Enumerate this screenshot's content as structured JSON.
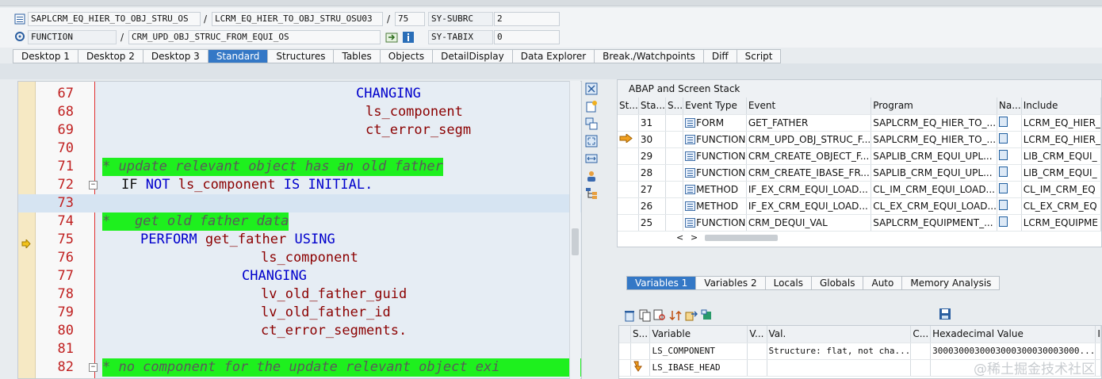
{
  "header": {
    "row1": {
      "program": "SAPLCRM_EQ_HIER_TO_OBJ_STRU_OS",
      "sep1": "/",
      "include": "LCRM_EQ_HIER_TO_OBJ_STRU_OSU03",
      "sep2": "/",
      "line": "75",
      "sysvar": "SY-SUBRC",
      "value": "2"
    },
    "row2": {
      "type": "FUNCTION",
      "sep1": "/",
      "name": "CRM_UPD_OBJ_STRUC_FROM_EQUI_OS",
      "sysvar": "SY-TABIX",
      "value": "0"
    }
  },
  "tabs": [
    "Desktop 1",
    "Desktop 2",
    "Desktop 3",
    "Standard",
    "Structures",
    "Tables",
    "Objects",
    "DetailDisplay",
    "Data Explorer",
    "Break./Watchpoints",
    "Diff",
    "Script"
  ],
  "active_tab": "Standard",
  "code_lines": [
    {
      "n": "67",
      "text": "CHANGING"
    },
    {
      "n": "68",
      "text": "ls_component"
    },
    {
      "n": "69",
      "text": "ct_error_segm"
    },
    {
      "n": "70",
      "text": ""
    },
    {
      "n": "71",
      "text": "* update relevant object has an old father"
    },
    {
      "n": "72",
      "kw1": "IF",
      "kw2": "NOT",
      "id": "ls_component",
      "kw3": "IS INITIAL."
    },
    {
      "n": "73",
      "text": ""
    },
    {
      "n": "74",
      "text": "*   get old father data"
    },
    {
      "n": "75",
      "kw1": "PERFORM",
      "id": "get_father",
      "kw2": "USING"
    },
    {
      "n": "76",
      "text": "ls_component"
    },
    {
      "n": "77",
      "text": "CHANGING"
    },
    {
      "n": "78",
      "text": "lv_old_father_guid"
    },
    {
      "n": "79",
      "text": "lv_old_father_id"
    },
    {
      "n": "80",
      "text": "ct_error_segments."
    },
    {
      "n": "81",
      "text": ""
    },
    {
      "n": "82",
      "text": "* no component for the update relevant object exi"
    }
  ],
  "stack": {
    "title": "ABAP and Screen Stack",
    "columns": [
      "St...",
      "Sta...",
      "S...",
      "Event Type",
      "Event",
      "Program",
      "Na...",
      "Include"
    ],
    "rows": [
      {
        "level": "31",
        "type": "FORM",
        "event": "GET_FATHER",
        "program": "SAPLCRM_EQ_HIER_TO_...",
        "include": "LCRM_EQ_HIER_"
      },
      {
        "level": "30",
        "type": "FUNCTION",
        "event": "CRM_UPD_OBJ_STRUC_F...",
        "program": "SAPLCRM_EQ_HIER_TO_...",
        "include": "LCRM_EQ_HIER_",
        "current": true
      },
      {
        "level": "29",
        "type": "FUNCTION",
        "event": "CRM_CREATE_OBJECT_F...",
        "program": "SAPLIB_CRM_EQUI_UPL...",
        "include": "LIB_CRM_EQUI_"
      },
      {
        "level": "28",
        "type": "FUNCTION",
        "event": "CRM_CREATE_IBASE_FR...",
        "program": "SAPLIB_CRM_EQUI_UPL...",
        "include": "LIB_CRM_EQUI_"
      },
      {
        "level": "27",
        "type": "METHOD",
        "event": "IF_EX_CRM_EQUI_LOAD...",
        "program": "CL_IM_CRM_EQUI_LOAD...",
        "include": "CL_IM_CRM_EQ"
      },
      {
        "level": "26",
        "type": "METHOD",
        "event": "IF_EX_CRM_EQUI_LOAD...",
        "program": "CL_EX_CRM_EQUI_LOAD...",
        "include": "CL_EX_CRM_EQ"
      },
      {
        "level": "25",
        "type": "FUNCTION",
        "event": "CRM_DEQUI_VAL",
        "program": "SAPLCRM_EQUIPMENT_...",
        "include": "LCRM_EQUIPME"
      }
    ],
    "scroll_left": "<",
    "scroll_right": ">"
  },
  "var_tabs": [
    "Variables 1",
    "Variables 2",
    "Locals",
    "Globals",
    "Auto",
    "Memory Analysis"
  ],
  "active_var_tab": "Variables 1",
  "vars": {
    "columns": [
      "S...",
      "Variable",
      "V...",
      "Val.",
      "C...",
      "Hexadecimal Value",
      "I"
    ],
    "rows": [
      {
        "name": "LS_COMPONENT",
        "val": "Structure: flat, not cha...",
        "hex": "3000300030003000300030003000..."
      },
      {
        "name": "LS_IBASE_HEAD",
        "val": "",
        "hex": ""
      }
    ]
  },
  "watermark": "@稀土掘金技术社区",
  "colors": {
    "active_tab": "#3478c6",
    "comment_bg": "#1ef01e",
    "keyword": "#0000cc",
    "identifier": "#8b0000",
    "line_number": "#c02020"
  }
}
